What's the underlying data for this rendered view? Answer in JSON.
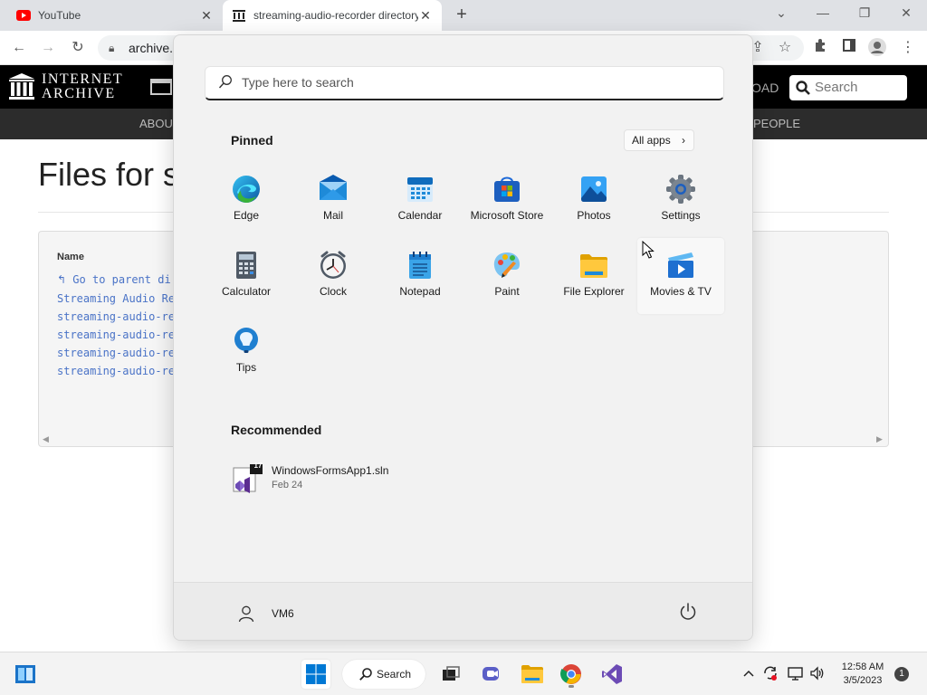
{
  "browser": {
    "tabs": [
      {
        "title": "YouTube",
        "icon": "youtube-icon"
      },
      {
        "title": "streaming-audio-recorder directory",
        "icon": "internet-archive-icon"
      }
    ],
    "url": "archive.org"
  },
  "archive_page": {
    "logo_line1": "INTERNET",
    "logo_line2": "ARCHIVE",
    "nav_left": "ABOUT",
    "nav_right": "PEOPLE",
    "upload_partial": "OAD",
    "search_placeholder": "Search",
    "heading": "Files for s",
    "column_name": "Name",
    "files": [
      "Go to parent di",
      "Streaming Audio Re",
      "streaming-audio-re",
      "streaming-audio-re",
      "streaming-audio-re",
      "streaming-audio-re"
    ]
  },
  "start_menu": {
    "search_placeholder": "Type here to search",
    "pinned_title": "Pinned",
    "all_apps_label": "All apps",
    "pinned_apps": [
      {
        "label": "Edge",
        "icon": "edge-icon"
      },
      {
        "label": "Mail",
        "icon": "mail-icon"
      },
      {
        "label": "Calendar",
        "icon": "calendar-icon"
      },
      {
        "label": "Microsoft Store",
        "icon": "store-icon"
      },
      {
        "label": "Photos",
        "icon": "photos-icon"
      },
      {
        "label": "Settings",
        "icon": "settings-icon"
      },
      {
        "label": "Calculator",
        "icon": "calculator-icon"
      },
      {
        "label": "Clock",
        "icon": "clock-icon"
      },
      {
        "label": "Notepad",
        "icon": "notepad-icon"
      },
      {
        "label": "Paint",
        "icon": "paint-icon"
      },
      {
        "label": "File Explorer",
        "icon": "folder-icon"
      },
      {
        "label": "Movies & TV",
        "icon": "movies-icon"
      },
      {
        "label": "Tips",
        "icon": "tips-icon"
      }
    ],
    "recommended_title": "Recommended",
    "recommended": [
      {
        "name": "WindowsFormsApp1.sln",
        "date": "Feb 24",
        "icon": "visual-studio-solution-icon",
        "badge": "17"
      }
    ],
    "user_name": "VM6"
  },
  "taskbar": {
    "search_label": "Search",
    "time": "12:58 AM",
    "date": "3/5/2023",
    "notification_count": "1"
  },
  "colors": {
    "accent": "#0067c0",
    "link": "#4a73c7",
    "taskbar_bg": "#f3f3f3",
    "start_bg": "#f2f2f2"
  }
}
